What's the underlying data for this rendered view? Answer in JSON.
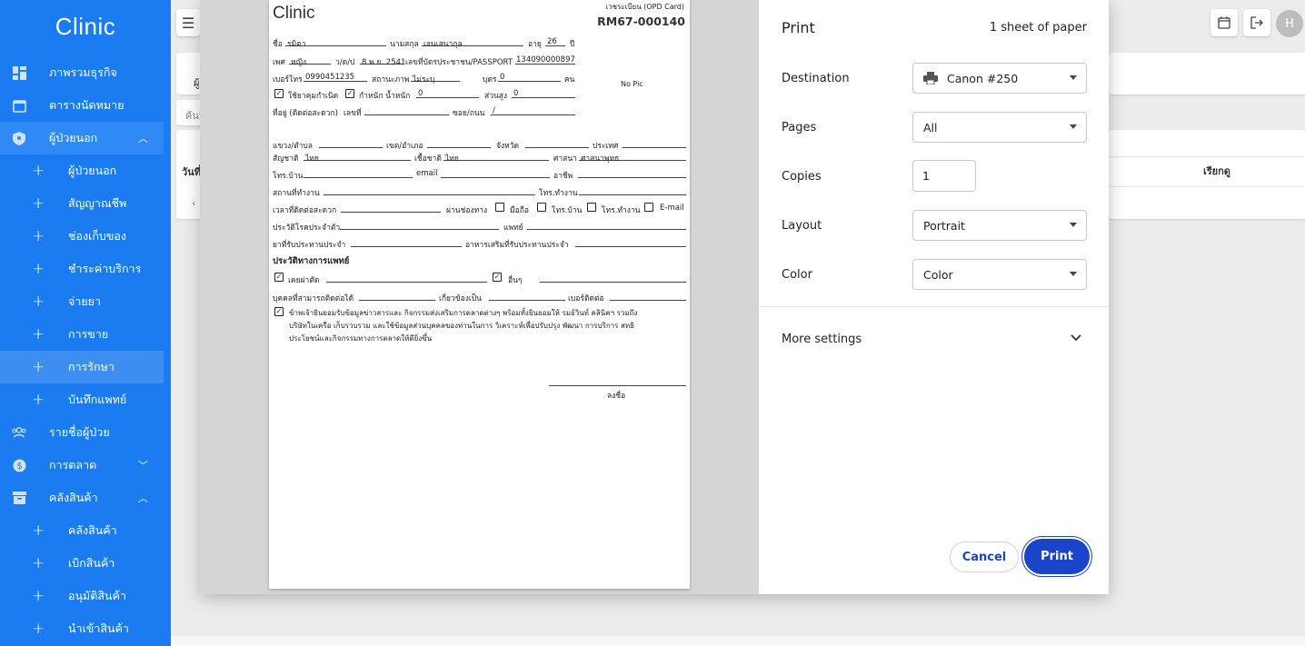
{
  "sidebar": {
    "brand": "Clinic",
    "items": [
      {
        "label": "ภาพรวมธุรกิจ"
      },
      {
        "label": "ตารางนัดหมาย"
      },
      {
        "label": "ผู้ป่วยนอก"
      },
      {
        "label": "ผู้ป่วยนอก"
      },
      {
        "label": "สัญญาณชีพ"
      },
      {
        "label": "ช่องเก็บของ"
      },
      {
        "label": "ชำระค่าบริการ"
      },
      {
        "label": "จ่ายยา"
      },
      {
        "label": "การขาย"
      },
      {
        "label": "การรักษา"
      },
      {
        "label": "บันทึกแพทย์"
      },
      {
        "label": "รายชื่อผู้ป่วย"
      },
      {
        "label": "การตลาด"
      },
      {
        "label": "คลังสินค้า"
      },
      {
        "label": "คลังสินค้า"
      },
      {
        "label": "เบิกสินค้า"
      },
      {
        "label": "อนุมัติสินค้า"
      },
      {
        "label": "นำเข้าสินค้า"
      }
    ]
  },
  "background": {
    "search_partial": "ค้นห",
    "header_partial": "ผู้",
    "col_left": "วันที่",
    "col_right": "เรียกดู",
    "avatar_initial": "H"
  },
  "preview": {
    "brand": "Clinic",
    "reg_label": "เวชระเบียน (OPD Card)",
    "reg_number": "RM67-000140",
    "no_pic": "No Pic",
    "name_label": "ชื่อ",
    "name_value": "รมิตา",
    "surname_label": "นามสกุล",
    "surname_value": "เจนเสนากุล",
    "age_label": "อายุ",
    "age_value": "26",
    "age_unit": "ปี",
    "sex_label": "เพศ",
    "sex_value": "หญิง",
    "dob_label": "ว/ด/ป",
    "dob_value": "8 พ.ย. 2541",
    "id_label": "เลขที่บัตรประชาชน/PASSPORT",
    "id_value": "134090000897",
    "phone_label": "เบอร์โทร",
    "phone_value": "0990451235",
    "marital_label": "สถานะภาพ",
    "marital_value": "ไม่ระบุ",
    "children_label": "บุตร",
    "children_value": "0",
    "children_unit": "คน",
    "contraceptive": "ใช้ยาคุมกำเนิด",
    "weight_label": "กำหนัก น้ำหนัก",
    "weight_value": "0",
    "height_label": "ส่วนสูง",
    "height_value": "0",
    "address_label": "ที่อยู่ (ติดต่อสะดวก)",
    "house_no_label": "เลขที่",
    "soi_label": "ซอย/ถนน",
    "soi_value": "/",
    "subdistrict_label": "แขวง/ตำบล",
    "district_label": "เขต/อำเภอ",
    "province_label": "จังหวัด",
    "country_label": "ประเทศ",
    "nationality_label": "สัญชาติ",
    "nationality_value": "ไทย",
    "race_label": "เชื้อชาติ",
    "race_value": "ไทย",
    "religion_label": "ศาสนา",
    "religion_value": "ศาสนาพุทธ",
    "homephone_label": "โทร.บ้าน",
    "email_label": "email",
    "occupation_label": "อาชีพ",
    "workplace_label": "สถานที่ทำงาน",
    "workphone_label": "โทร.ทำงาน",
    "contact_time_label": "เวลาที่ติดต่อสะดวก",
    "via_label": "ผ่านช่องทาง",
    "via_mobile": "มือถือ",
    "via_home": "โทร.บ้าน",
    "via_work": "โทร.ทำงาน",
    "via_email": "E-mail",
    "disease_label": "ประวัติโรคประจำตัว",
    "doctor_label": "แพทย์",
    "medication_label": "ยาที่รับประทานประจำ",
    "supplement_label": "อาหารเสริมที่รับประทานประจำ",
    "medical_history": "ประวัติทางการแพทย์",
    "surgery": "เคยผ่าตัด",
    "other": "อื่นๆ",
    "emergency_label": "บุคคลที่สามารถติดต่อได้",
    "relation_label": "เกี่ยวข้องเป็น",
    "contact_no_label": "เบอร์ติดต่อ",
    "consent_1": "ข้าพเจ้ายินยอมรับข้อมูลข่าวสารและ กิจกรรมส่งเสริมการตลาดต่างๆ พร้อมทั้งยินยอมให้ รมย์วินท์ คลินิคฯ รวมถึง",
    "consent_2": "บริษัทในเครือ เก็บรวบรวม และใช้ข้อมูลส่วนบุคคลของท่านในการ วิเคราะห์เพื่อปรับปรุง พัฒนา การบริการ สทธิ",
    "consent_3": "ประโยชน์และกิจกรรมทางการตลาดให้ดียิ่งขึ้น",
    "sign_label": "ลงชื่อ"
  },
  "print": {
    "title": "Print",
    "sheets": "1 sheet of paper",
    "destination_label": "Destination",
    "destination_value": "Canon #250",
    "pages_label": "Pages",
    "pages_value": "All",
    "copies_label": "Copies",
    "copies_value": "1",
    "layout_label": "Layout",
    "layout_value": "Portrait",
    "color_label": "Color",
    "color_value": "Color",
    "more_settings": "More settings",
    "cancel": "Cancel",
    "print": "Print"
  },
  "colors": {
    "sidebar": "#1a7cf0",
    "primary_button": "#1a45c9"
  }
}
